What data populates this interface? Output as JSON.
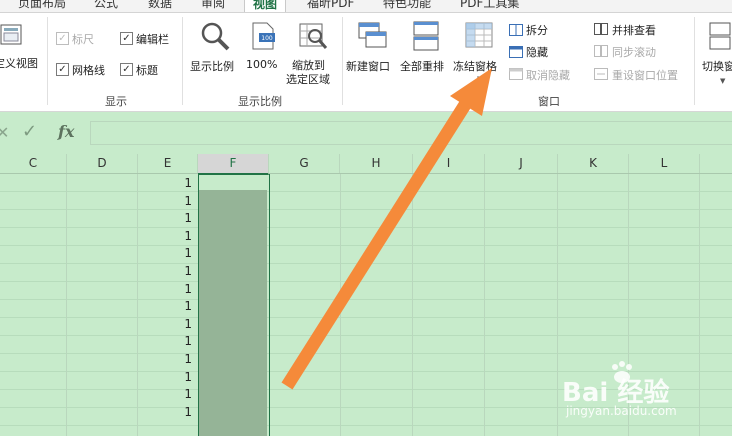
{
  "tabs": [
    {
      "label": "页面布局"
    },
    {
      "label": "公式"
    },
    {
      "label": "数据"
    },
    {
      "label": "审阅"
    },
    {
      "label": "视图"
    },
    {
      "label": "福昕PDF"
    },
    {
      "label": "特色功能"
    },
    {
      "label": "PDF工具集"
    }
  ],
  "ribbon": {
    "custom_view": "定义视图",
    "show": {
      "ruler": "标尺",
      "formula_bar": "编辑栏",
      "gridlines": "网格线",
      "headings": "标题",
      "group_label": "显示"
    },
    "zoom": {
      "zoom": "显示比例",
      "pct100": "100%",
      "zoom_sel_1": "缩放到",
      "zoom_sel_2": "选定区域",
      "group_label": "显示比例"
    },
    "window": {
      "new_window": "新建窗口",
      "arrange_all": "全部重排",
      "freeze": "冻结窗格",
      "split": "拆分",
      "hide": "隐藏",
      "unhide": "取消隐藏",
      "side_by_side": "并排查看",
      "sync_scroll": "同步滚动",
      "reset_pos": "重设窗口位置",
      "switch": "切换窗",
      "group_label": "窗口"
    }
  },
  "formula_bar": {
    "fx": "fx"
  },
  "columns": [
    "C",
    "D",
    "E",
    "F",
    "G",
    "H",
    "I",
    "J",
    "K",
    "L"
  ],
  "cell_value": "1",
  "row_values": [
    "1",
    "1",
    "1",
    "1",
    "1",
    "1",
    "1",
    "1",
    "1",
    "1",
    "1",
    "1",
    "1",
    "1"
  ],
  "watermark": {
    "brand": "Bai 经验",
    "url": "jingyan.baidu.com"
  },
  "colors": {
    "accent": "#217346",
    "arrow": "#f58a3a",
    "sheet_bg": "#c7ebcb"
  }
}
